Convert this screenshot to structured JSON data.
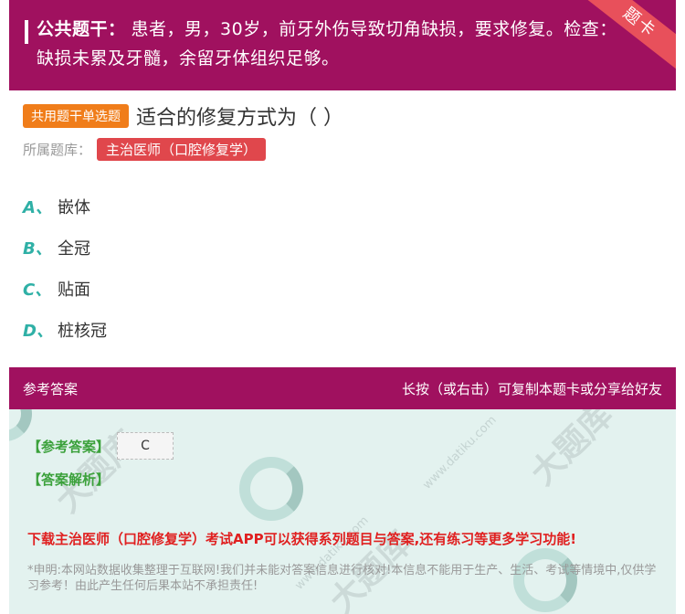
{
  "stem": {
    "label": "公共题干：",
    "text": "患者，男，30岁，前牙外伤导致切角缺损，要求修复。检查：缺损未累及牙髓，余留牙体组织足够。",
    "corner_label": "题卡"
  },
  "question": {
    "type_badge": "共用题干单选题",
    "text": "适合的修复方式为（ ）",
    "bank_label": "所属题库：",
    "bank_name": "主治医师（口腔修复学）"
  },
  "options": [
    {
      "letter": "A、",
      "text": "嵌体"
    },
    {
      "letter": "B、",
      "text": "全冠"
    },
    {
      "letter": "C、",
      "text": "贴面"
    },
    {
      "letter": "D、",
      "text": "桩核冠"
    }
  ],
  "answer_panel": {
    "title": "参考答案",
    "hint": "长按（或右击）可复制本题卡或分享给好友",
    "ref_label": "【参考答案】",
    "ref_value": "C",
    "analysis_label": "【答案解析】",
    "promo": "下载主治医师（口腔修复学）考试APP可以获得系列题目与答案,还有练习等更多学习功能!",
    "disclaimer": "*申明:本网站数据收集整理于互联网!我们并未能对答案信息进行核对!本信息不能用于生产、生活、考试等情境中,仅供学习参考！由此产生任何后果本站不承担责任!"
  },
  "colors": {
    "brand": "#a0115f",
    "badge_orange": "#f07d1a",
    "badge_red": "#e0474c",
    "option_letter": "#2fb0a6",
    "answer_green": "#3ba13b",
    "promo_red": "#e02020"
  }
}
